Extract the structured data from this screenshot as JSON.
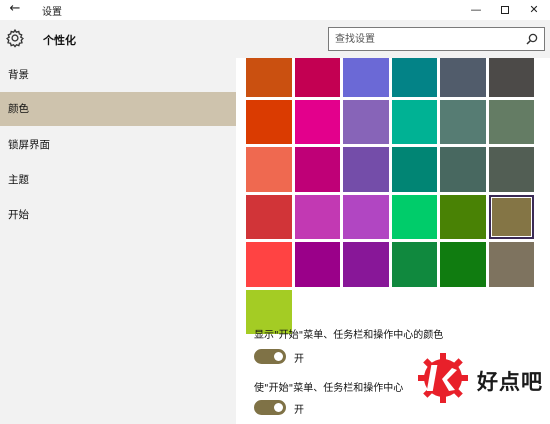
{
  "window": {
    "back_icon": "back-arrow-icon",
    "title": "设置",
    "min_label": "—",
    "close_label": "✕"
  },
  "header": {
    "icon": "gear-icon",
    "title": "个性化",
    "search_placeholder": "查找设置",
    "search_icon": "search-icon"
  },
  "sidebar": {
    "items": [
      {
        "label": "背景",
        "active": false
      },
      {
        "label": "颜色",
        "active": true
      },
      {
        "label": "锁屏界面",
        "active": false
      },
      {
        "label": "主题",
        "active": false
      },
      {
        "label": "开始",
        "active": false
      }
    ]
  },
  "colors": {
    "rows": [
      [
        "#ca5010",
        "#c30052",
        "#6b69d6",
        "#038387",
        "#515c6b",
        "#4c4a48"
      ],
      [
        "#da3b01",
        "#e3008c",
        "#8764b8",
        "#00b294",
        "#567c73",
        "#647c64"
      ],
      [
        "#ef6950",
        "#bf0077",
        "#744da9",
        "#018574",
        "#486860",
        "#525e54"
      ],
      [
        "#d13438",
        "#c239b3",
        "#b146c2",
        "#00cc6a",
        "#498205",
        "#847545"
      ],
      [
        "#ff4343",
        "#9a0089",
        "#881798",
        "#10893e",
        "#107c10",
        "#7e735f"
      ],
      [
        "#a4cc24"
      ]
    ],
    "selected": "#847545",
    "accent": "#7f7246"
  },
  "settings": {
    "start_taskbar_action_center": {
      "label": "显示\"开始\"菜单、任务栏和操作中心的颜色",
      "state_label": "开",
      "on": true
    },
    "transparency": {
      "label": "使\"开始\"菜单、任务栏和操作中心",
      "state_label": "开",
      "on": true
    }
  },
  "watermark": {
    "text": "好点吧",
    "logo_letter": "k"
  }
}
